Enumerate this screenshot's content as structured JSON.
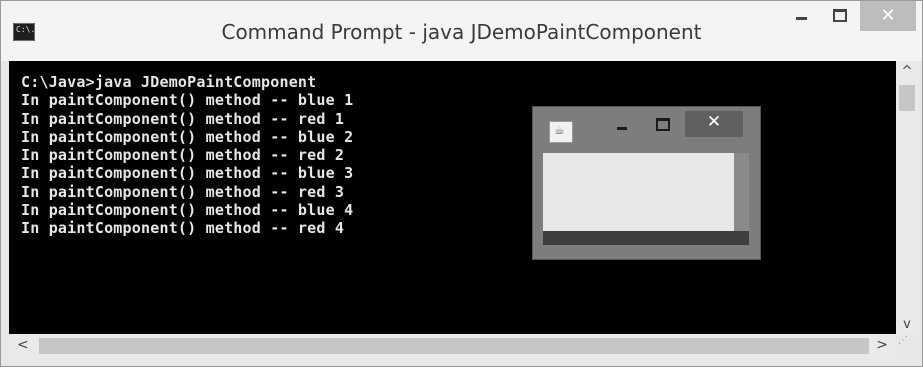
{
  "window": {
    "title": "Command Prompt - java  JDemoPaintComponent",
    "icon_label": "C:\\.",
    "icon_name": "command-prompt-icon",
    "minimize_symbol": "",
    "maximize_symbol": "",
    "close_symbol": "✕"
  },
  "console": {
    "lines": [
      "C:\\Java>java JDemoPaintComponent",
      "In paintComponent() method -- blue 1",
      "In paintComponent() method -- red 1",
      "In paintComponent() method -- blue 2",
      "In paintComponent() method -- red 2",
      "In paintComponent() method -- blue 3",
      "In paintComponent() method -- red 3",
      "In paintComponent() method -- blue 4",
      "In paintComponent() method -- red 4"
    ]
  },
  "scrollbars": {
    "up_arrow": "^",
    "down_arrow": "v",
    "left_arrow": "<",
    "right_arrow": ">"
  },
  "java_frame": {
    "icon_name": "java-cup-icon",
    "icon_glyph": "☕",
    "close_symbol": "✕"
  },
  "colors": {
    "console_bg": "#000000",
    "console_text": "#e6e6e6",
    "frame_bg": "#7d7d7d",
    "frame_content": "#e8e8e8"
  }
}
